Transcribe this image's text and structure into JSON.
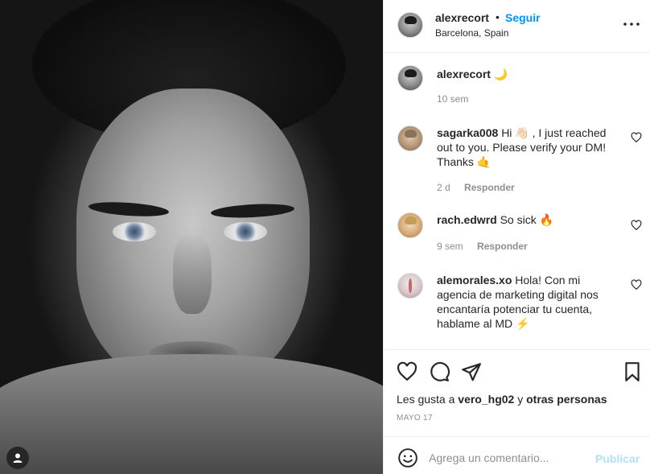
{
  "post": {
    "username": "alexrecort",
    "dot": "•",
    "follow_label": "Seguir",
    "location": "Barcelona, Spain",
    "more_icon": "more-horizontal-icon"
  },
  "caption": {
    "username": "alexrecort",
    "text": "🌙",
    "time": "10 sem"
  },
  "comments": [
    {
      "username": "sagarka008",
      "text": "Hi 👋🏻 , I just reached out to you. Please verify your DM! Thanks 🤙",
      "time": "2 d",
      "reply_label": "Responder"
    },
    {
      "username": "rach.edwrd",
      "text": "So sick 🔥",
      "time": "9 sem",
      "reply_label": "Responder"
    },
    {
      "username": "alemorales.xo",
      "text": "Hola! Con mi agencia de marketing digital nos encantaría potenciar tu cuenta, hablame al MD ⚡️",
      "time": "",
      "reply_label": ""
    }
  ],
  "likes": {
    "prefix": "Les gusta a",
    "user": "vero_hg02",
    "connector": "y",
    "others": "otras personas"
  },
  "date": "MAYO 17",
  "add_comment": {
    "placeholder": "Agrega un comentario...",
    "post_label": "Publicar"
  },
  "colors": {
    "accent": "#0095f6",
    "post_disabled": "#b2dffc",
    "muted": "#8e8e8e",
    "text": "#262626"
  }
}
